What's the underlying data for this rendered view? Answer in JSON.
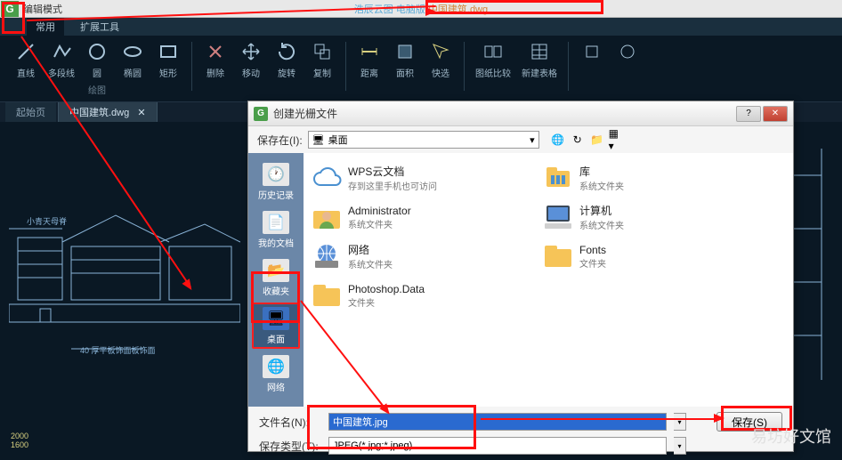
{
  "topbar": {
    "mode_label": "编辑模式",
    "title_left": "浩辰云图 电脑版",
    "title_right": "中国建筑.dwg"
  },
  "ribbon_tabs": [
    "常用",
    "扩展工具"
  ],
  "ribbon": {
    "buttons": [
      "直线",
      "多段线",
      "圆",
      "椭圆",
      "矩形",
      "删除",
      "移动",
      "旋转",
      "复制",
      "距离",
      "面积",
      "快选",
      "图纸比较",
      "新建表格"
    ],
    "panel1_label": "绘图"
  },
  "doc_tabs": {
    "start": "起始页",
    "active": "中国建筑.dwg"
  },
  "dialog": {
    "title": "创建光栅文件",
    "save_in_label": "保存在(I):",
    "save_in_value": "桌面",
    "sidebar": [
      "历史记录",
      "我的文档",
      "收藏夹",
      "桌面",
      "网络"
    ],
    "items": [
      {
        "name": "WPS云文档",
        "sub": "存到这里手机也可访问"
      },
      {
        "name": "库",
        "sub": "系统文件夹"
      },
      {
        "name": "Administrator",
        "sub": "系统文件夹"
      },
      {
        "name": "计算机",
        "sub": "系统文件夹"
      },
      {
        "name": "网络",
        "sub": "系统文件夹"
      },
      {
        "name": "Fonts",
        "sub": "文件夹"
      },
      {
        "name": "Photoshop.Data",
        "sub": "文件夹"
      }
    ],
    "filename_label": "文件名(N):",
    "filename_value": "中国建筑.jpg",
    "filetype_label": "保存类型(T):",
    "filetype_value": "JPEG(*.jpg;*.jpeg)",
    "save_btn": "保存(S)"
  },
  "drawing": {
    "label1": "小青天母脊",
    "label2": "40 厚平板饰面板饰面"
  },
  "watermark": "易坊好文馆"
}
